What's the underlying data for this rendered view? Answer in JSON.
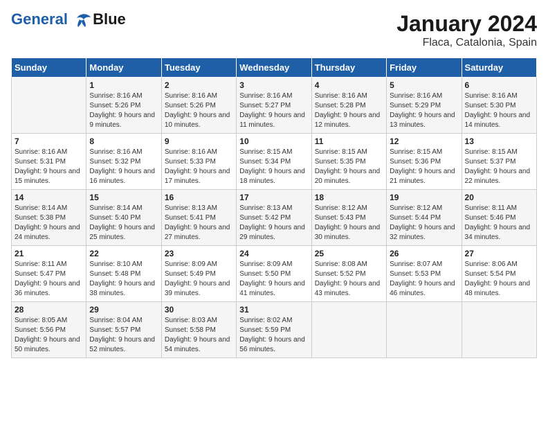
{
  "header": {
    "logo_line1": "General",
    "logo_line2": "Blue",
    "month": "January 2024",
    "location": "Flaca, Catalonia, Spain"
  },
  "days_of_week": [
    "Sunday",
    "Monday",
    "Tuesday",
    "Wednesday",
    "Thursday",
    "Friday",
    "Saturday"
  ],
  "weeks": [
    [
      {
        "day": "",
        "sunrise": "",
        "sunset": "",
        "daylight": ""
      },
      {
        "day": "1",
        "sunrise": "Sunrise: 8:16 AM",
        "sunset": "Sunset: 5:26 PM",
        "daylight": "Daylight: 9 hours and 9 minutes."
      },
      {
        "day": "2",
        "sunrise": "Sunrise: 8:16 AM",
        "sunset": "Sunset: 5:26 PM",
        "daylight": "Daylight: 9 hours and 10 minutes."
      },
      {
        "day": "3",
        "sunrise": "Sunrise: 8:16 AM",
        "sunset": "Sunset: 5:27 PM",
        "daylight": "Daylight: 9 hours and 11 minutes."
      },
      {
        "day": "4",
        "sunrise": "Sunrise: 8:16 AM",
        "sunset": "Sunset: 5:28 PM",
        "daylight": "Daylight: 9 hours and 12 minutes."
      },
      {
        "day": "5",
        "sunrise": "Sunrise: 8:16 AM",
        "sunset": "Sunset: 5:29 PM",
        "daylight": "Daylight: 9 hours and 13 minutes."
      },
      {
        "day": "6",
        "sunrise": "Sunrise: 8:16 AM",
        "sunset": "Sunset: 5:30 PM",
        "daylight": "Daylight: 9 hours and 14 minutes."
      }
    ],
    [
      {
        "day": "7",
        "sunrise": "Sunrise: 8:16 AM",
        "sunset": "Sunset: 5:31 PM",
        "daylight": "Daylight: 9 hours and 15 minutes."
      },
      {
        "day": "8",
        "sunrise": "Sunrise: 8:16 AM",
        "sunset": "Sunset: 5:32 PM",
        "daylight": "Daylight: 9 hours and 16 minutes."
      },
      {
        "day": "9",
        "sunrise": "Sunrise: 8:16 AM",
        "sunset": "Sunset: 5:33 PM",
        "daylight": "Daylight: 9 hours and 17 minutes."
      },
      {
        "day": "10",
        "sunrise": "Sunrise: 8:15 AM",
        "sunset": "Sunset: 5:34 PM",
        "daylight": "Daylight: 9 hours and 18 minutes."
      },
      {
        "day": "11",
        "sunrise": "Sunrise: 8:15 AM",
        "sunset": "Sunset: 5:35 PM",
        "daylight": "Daylight: 9 hours and 20 minutes."
      },
      {
        "day": "12",
        "sunrise": "Sunrise: 8:15 AM",
        "sunset": "Sunset: 5:36 PM",
        "daylight": "Daylight: 9 hours and 21 minutes."
      },
      {
        "day": "13",
        "sunrise": "Sunrise: 8:15 AM",
        "sunset": "Sunset: 5:37 PM",
        "daylight": "Daylight: 9 hours and 22 minutes."
      }
    ],
    [
      {
        "day": "14",
        "sunrise": "Sunrise: 8:14 AM",
        "sunset": "Sunset: 5:38 PM",
        "daylight": "Daylight: 9 hours and 24 minutes."
      },
      {
        "day": "15",
        "sunrise": "Sunrise: 8:14 AM",
        "sunset": "Sunset: 5:40 PM",
        "daylight": "Daylight: 9 hours and 25 minutes."
      },
      {
        "day": "16",
        "sunrise": "Sunrise: 8:13 AM",
        "sunset": "Sunset: 5:41 PM",
        "daylight": "Daylight: 9 hours and 27 minutes."
      },
      {
        "day": "17",
        "sunrise": "Sunrise: 8:13 AM",
        "sunset": "Sunset: 5:42 PM",
        "daylight": "Daylight: 9 hours and 29 minutes."
      },
      {
        "day": "18",
        "sunrise": "Sunrise: 8:12 AM",
        "sunset": "Sunset: 5:43 PM",
        "daylight": "Daylight: 9 hours and 30 minutes."
      },
      {
        "day": "19",
        "sunrise": "Sunrise: 8:12 AM",
        "sunset": "Sunset: 5:44 PM",
        "daylight": "Daylight: 9 hours and 32 minutes."
      },
      {
        "day": "20",
        "sunrise": "Sunrise: 8:11 AM",
        "sunset": "Sunset: 5:46 PM",
        "daylight": "Daylight: 9 hours and 34 minutes."
      }
    ],
    [
      {
        "day": "21",
        "sunrise": "Sunrise: 8:11 AM",
        "sunset": "Sunset: 5:47 PM",
        "daylight": "Daylight: 9 hours and 36 minutes."
      },
      {
        "day": "22",
        "sunrise": "Sunrise: 8:10 AM",
        "sunset": "Sunset: 5:48 PM",
        "daylight": "Daylight: 9 hours and 38 minutes."
      },
      {
        "day": "23",
        "sunrise": "Sunrise: 8:09 AM",
        "sunset": "Sunset: 5:49 PM",
        "daylight": "Daylight: 9 hours and 39 minutes."
      },
      {
        "day": "24",
        "sunrise": "Sunrise: 8:09 AM",
        "sunset": "Sunset: 5:50 PM",
        "daylight": "Daylight: 9 hours and 41 minutes."
      },
      {
        "day": "25",
        "sunrise": "Sunrise: 8:08 AM",
        "sunset": "Sunset: 5:52 PM",
        "daylight": "Daylight: 9 hours and 43 minutes."
      },
      {
        "day": "26",
        "sunrise": "Sunrise: 8:07 AM",
        "sunset": "Sunset: 5:53 PM",
        "daylight": "Daylight: 9 hours and 46 minutes."
      },
      {
        "day": "27",
        "sunrise": "Sunrise: 8:06 AM",
        "sunset": "Sunset: 5:54 PM",
        "daylight": "Daylight: 9 hours and 48 minutes."
      }
    ],
    [
      {
        "day": "28",
        "sunrise": "Sunrise: 8:05 AM",
        "sunset": "Sunset: 5:56 PM",
        "daylight": "Daylight: 9 hours and 50 minutes."
      },
      {
        "day": "29",
        "sunrise": "Sunrise: 8:04 AM",
        "sunset": "Sunset: 5:57 PM",
        "daylight": "Daylight: 9 hours and 52 minutes."
      },
      {
        "day": "30",
        "sunrise": "Sunrise: 8:03 AM",
        "sunset": "Sunset: 5:58 PM",
        "daylight": "Daylight: 9 hours and 54 minutes."
      },
      {
        "day": "31",
        "sunrise": "Sunrise: 8:02 AM",
        "sunset": "Sunset: 5:59 PM",
        "daylight": "Daylight: 9 hours and 56 minutes."
      },
      {
        "day": "",
        "sunrise": "",
        "sunset": "",
        "daylight": ""
      },
      {
        "day": "",
        "sunrise": "",
        "sunset": "",
        "daylight": ""
      },
      {
        "day": "",
        "sunrise": "",
        "sunset": "",
        "daylight": ""
      }
    ]
  ]
}
